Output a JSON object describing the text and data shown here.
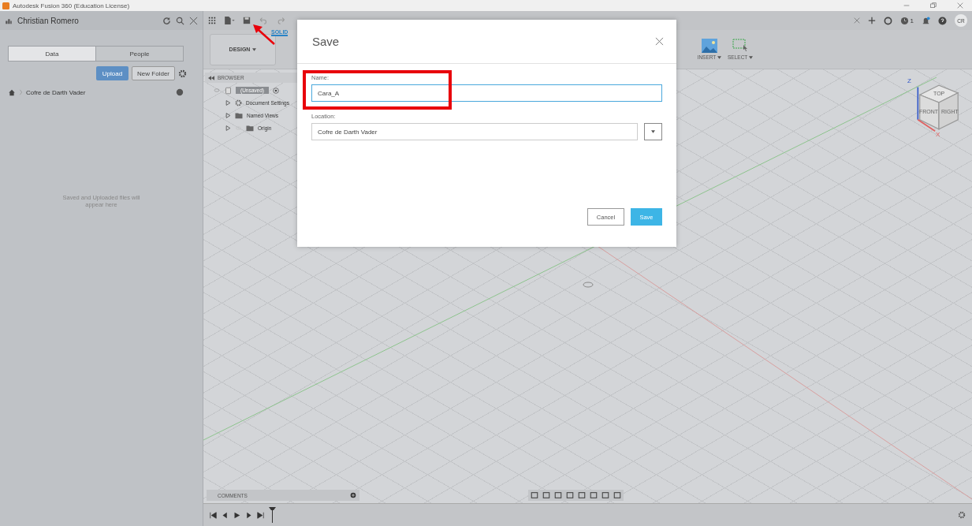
{
  "window": {
    "title": "Autodesk Fusion 360 (Education License)"
  },
  "data_panel": {
    "user": "Christian Romero",
    "tabs": [
      {
        "label": "Data",
        "selected": true
      },
      {
        "label": "People",
        "selected": false
      }
    ],
    "upload": "Upload",
    "new_folder": "New Folder",
    "breadcrumb": "Cofre de Darth Vader",
    "empty_message": "Saved and Uploaded files will appear here"
  },
  "app_bar": {
    "job_count": "1",
    "avatar": "CR"
  },
  "toolbar": {
    "workspace": "DESIGN",
    "tab": "SOLID",
    "insert": "INSERT",
    "select": "SELECT"
  },
  "browser": {
    "title": "BROWSER",
    "root": "(Unsaved)",
    "items": [
      {
        "kind": "settings",
        "label": "Document Settings"
      },
      {
        "kind": "folder",
        "label": "Named Views"
      },
      {
        "kind": "hidden-folder",
        "label": "Origin"
      }
    ]
  },
  "viewcube": {
    "top": "TOP",
    "front": "FRONT",
    "right": "RIGHT",
    "z": "Z",
    "x": "X"
  },
  "comments": {
    "title": "COMMENTS"
  },
  "dialog": {
    "title": "Save",
    "name_label": "Name:",
    "name_value": "Cara_A",
    "location_label": "Location:",
    "location_value": "Cofre de Darth Vader",
    "cancel": "Cancel",
    "save": "Save"
  }
}
